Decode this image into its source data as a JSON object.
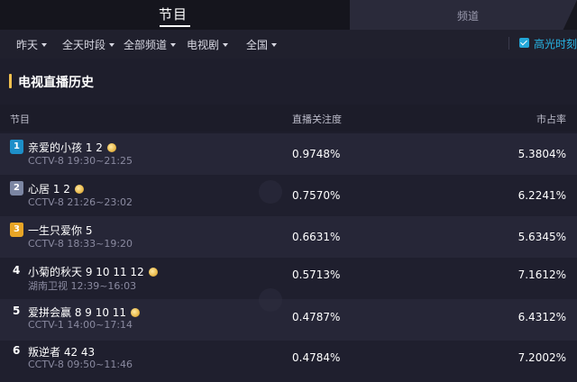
{
  "tabs": {
    "active": "节目",
    "inactive": "频道"
  },
  "filters": [
    {
      "label": "昨天"
    },
    {
      "label": "全天时段"
    },
    {
      "label": "全部频道"
    },
    {
      "label": "电视剧"
    },
    {
      "label": "全国"
    }
  ],
  "highlight_toggle": {
    "label": "高光时刻",
    "checked": true
  },
  "section": {
    "title": "电视直播历史"
  },
  "table": {
    "headers": {
      "program": "节目",
      "attention": "直播关注度",
      "share": "市占率"
    },
    "rows": [
      {
        "rank": "1",
        "title": "亲爱的小孩 1 2",
        "sub": "CCTV-8 19:30~21:25",
        "attention": "0.9748%",
        "share": "5.3804%"
      },
      {
        "rank": "2",
        "title": "心居 1 2",
        "sub": "CCTV-8 21:26~23:02",
        "attention": "0.7570%",
        "share": "6.2241%"
      },
      {
        "rank": "3",
        "title": "一生只爱你 5",
        "sub": "CCTV-8 18:33~19:20",
        "attention": "0.6631%",
        "share": "5.6345%"
      },
      {
        "rank": "4",
        "title": "小菊的秋天 9 10 11 12",
        "sub": "湖南卫视 12:39~16:03",
        "attention": "0.5713%",
        "share": "7.1612%"
      },
      {
        "rank": "5",
        "title": "爱拼会赢 8 9 10 11",
        "sub": "CCTV-1 14:00~17:14",
        "attention": "0.4787%",
        "share": "6.4312%"
      },
      {
        "rank": "6",
        "title": "叛逆者 42 43",
        "sub": "CCTV-8 09:50~11:46",
        "attention": "0.4784%",
        "share": "7.2002%"
      }
    ]
  },
  "colors": {
    "background": "#1e1e2c",
    "accent_blue": "#27b6e6",
    "section_accent": "#f2c14e",
    "rank1": "#1d8fc9",
    "rank2": "#7c86a3",
    "rank3": "#e8a526"
  }
}
